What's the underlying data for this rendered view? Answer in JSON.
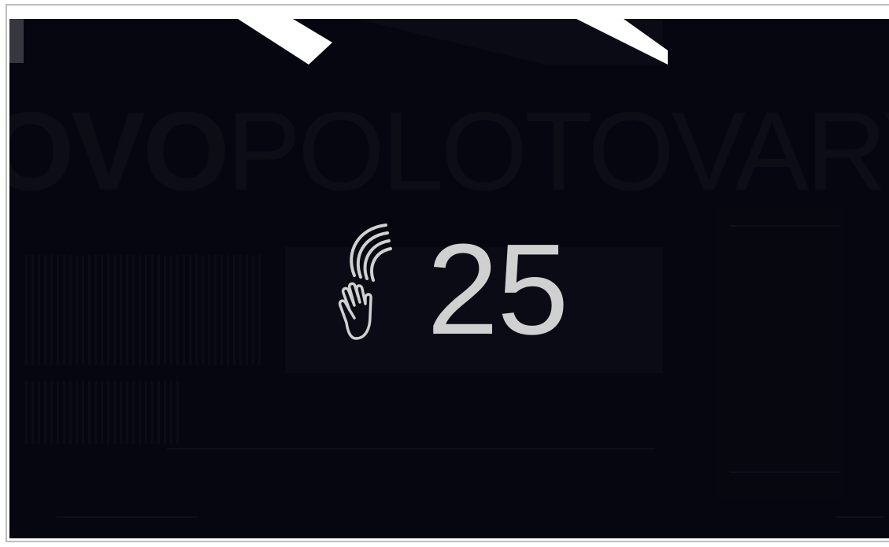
{
  "background": {
    "brand_text_bold": "OVO",
    "brand_text_light": "POLOTOVARY"
  },
  "overlay": {
    "gesture_icon": "hand-wave-icon",
    "counter_value": "25"
  },
  "colors": {
    "screen_bg": "#05060f",
    "counter_color": "#d0d0d0",
    "frame": "#ffffff"
  }
}
